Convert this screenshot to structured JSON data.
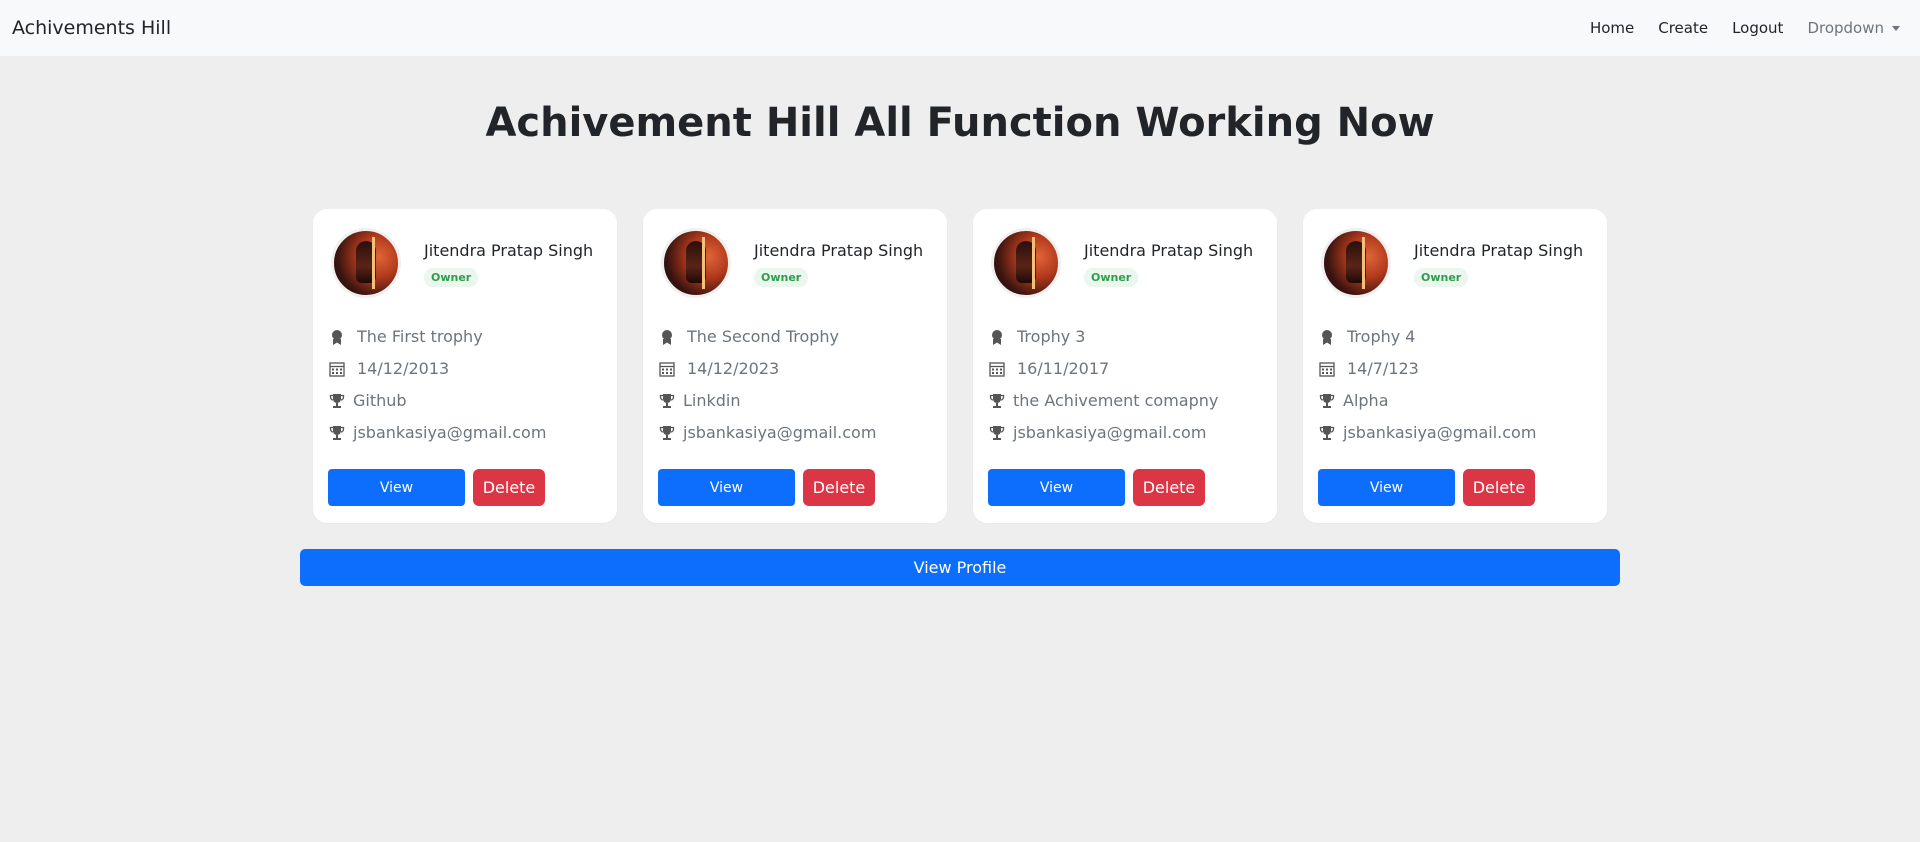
{
  "navbar": {
    "brand": "Achivements Hill",
    "links": [
      "Home",
      "Create",
      "Logout"
    ],
    "dropdown": "Dropdown"
  },
  "page": {
    "title": "Achivement Hill All Function Working Now"
  },
  "cards": [
    {
      "name": "Jitendra Pratap Singh",
      "badge": "Owner",
      "trophy": "The First trophy",
      "date": "14/12/2013",
      "company": "Github",
      "email": "jsbankasiya@gmail.com",
      "view_label": "View",
      "delete_label": "Delete"
    },
    {
      "name": "Jitendra Pratap Singh",
      "badge": "Owner",
      "trophy": "The Second Trophy",
      "date": "14/12/2023",
      "company": "Linkdin",
      "email": "jsbankasiya@gmail.com",
      "view_label": "View",
      "delete_label": "Delete"
    },
    {
      "name": "Jitendra Pratap Singh",
      "badge": "Owner",
      "trophy": "Trophy 3",
      "date": "16/11/2017",
      "company": "the Achivement comapny",
      "email": "jsbankasiya@gmail.com",
      "view_label": "View",
      "delete_label": "Delete"
    },
    {
      "name": "Jitendra Pratap Singh",
      "badge": "Owner",
      "trophy": "Trophy 4",
      "date": "14/7/123",
      "company": "Alpha",
      "email": "jsbankasiya@gmail.com",
      "view_label": "View",
      "delete_label": "Delete"
    }
  ],
  "profile_button": "View Profile",
  "icons": {
    "avatar": "user-avatar-image",
    "trophy_name": "award-icon",
    "date": "calendar-icon",
    "company": "trophy-icon",
    "email": "trophy-icon"
  },
  "colors": {
    "primary": "#0d6efd",
    "danger": "#dc3545",
    "badge_text": "#2e9e4a",
    "background": "#eeeeee"
  }
}
